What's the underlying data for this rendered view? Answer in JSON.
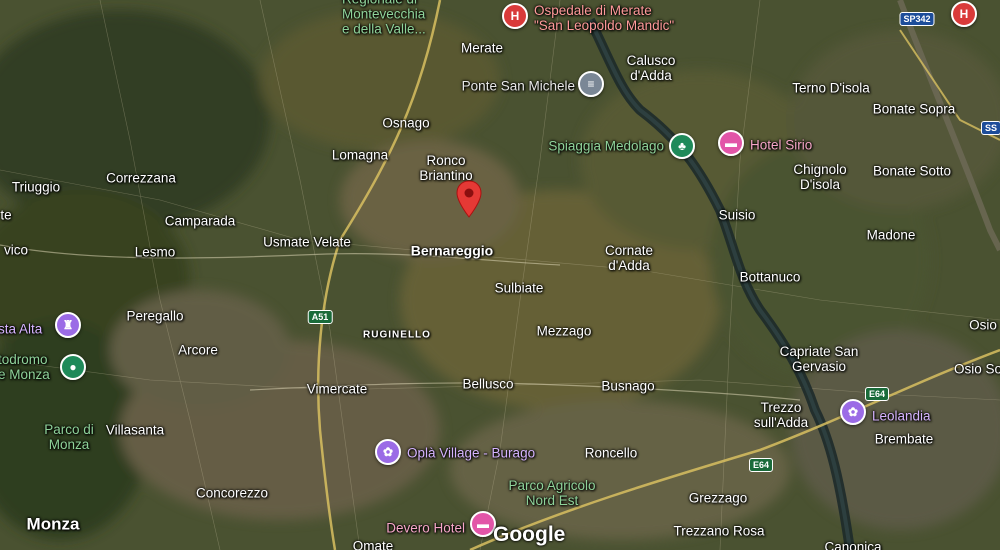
{
  "places": {
    "montevecchia": "Regionale di\nMontevecchia\ne della Valle...",
    "ospedale_merate": "Ospedale di Merate\n\"San Leopoldo Mandic\"",
    "merate": "Merate",
    "calusco": "Calusco\nd'Adda",
    "terno": "Terno D'isola",
    "bonate_sopra": "Bonate Sopra",
    "ponte_san_michele": "Ponte San Michele",
    "osnago": "Osnago",
    "lomagna": "Lomagna",
    "ronco": "Ronco\nBriantino",
    "spiaggia": "Spiaggia Medolago",
    "hotel_sirio": "Hotel Sirio",
    "chignolo": "Chignolo\nD'isola",
    "bonate_sotto": "Bonate Sotto",
    "triuggio": "Triuggio",
    "correzzana": "Correzzana",
    "camparada": "Camparada",
    "suisio": "Suisio",
    "madone": "Madone",
    "usmate": "Usmate Velate",
    "bernareggio": "Bernareggio",
    "cornate": "Cornate\nd'Adda",
    "lesmo": "Lesmo",
    "vico": "vico",
    "te": "te",
    "bottanuco": "Bottanuco",
    "sulbiate": "Sulbiate",
    "peregallo": "Peregallo",
    "sta_alta": "sta Alta",
    "ruginello": "RUGINELLO",
    "mezzago": "Mezzago",
    "osio": "Osio",
    "capriate": "Capriate San\nGervasio",
    "osio_so": "Osio So",
    "arcore": "Arcore",
    "todromo": "todromo\ne Monza",
    "vimercate": "Vimercate",
    "bellusco": "Bellusco",
    "busnago": "Busnago",
    "trezzo": "Trezzo\nsull'Adda",
    "leolandia": "Leolandia",
    "parco_monza": "Parco di\nMonza",
    "villasanta": "Villasanta",
    "brembate": "Brembate",
    "opla": "Oplà Village - Burago",
    "roncello": "Roncello",
    "parco_agricolo": "Parco Agricolo\nNord Est",
    "concorezzo": "Concorezzo",
    "grezzago": "Grezzago",
    "monza": "Monza",
    "devero": "Devero Hotel",
    "trezzano": "Trezzano Rosa",
    "omate": "Omate",
    "canonica": "Canonica"
  },
  "roads": {
    "sp342": "SP342",
    "a51": "A51",
    "e64a": "E64",
    "e64b": "E64",
    "ss": "SS"
  },
  "icons": {
    "hospital": "H",
    "bridge": "≡",
    "park": "♣",
    "hotel": "▬",
    "castle": "♜",
    "amusement": "✿",
    "circle": "●"
  },
  "attribution": "Google",
  "colors": {
    "hospital": "#d93a3a",
    "hotel": "#e255a8",
    "park": "#1f8a5a",
    "amusement": "#9b6be6",
    "landmark": "#7a8796",
    "marker": "#e53935"
  }
}
